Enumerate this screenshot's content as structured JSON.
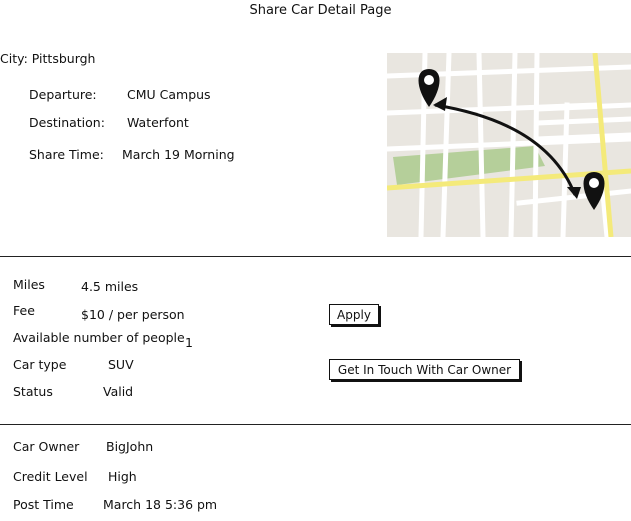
{
  "page": {
    "title": "Share Car Detail Page"
  },
  "city": {
    "label": "City:",
    "value": "Pittsburgh"
  },
  "trip": {
    "departure_label": "Departure:",
    "departure_value": "CMU Campus",
    "destination_label": "Destination:",
    "destination_value": "Waterfont",
    "share_time_label": "Share Time:",
    "share_time_value": "March 19 Morning"
  },
  "details": {
    "miles_label": "Miles",
    "miles_value": "4.5 miles",
    "fee_label": "Fee",
    "fee_value": "$10 / per person",
    "available_label": "Available number of people",
    "available_value": "1",
    "car_type_label": "Car type",
    "car_type_value": "SUV",
    "status_label": "Status",
    "status_value": "Valid"
  },
  "actions": {
    "apply_label": "Apply",
    "contact_label": "Get In Touch With Car Owner"
  },
  "owner": {
    "owner_label": "Car Owner",
    "owner_value": "BigJohn",
    "credit_label": "Credit Level",
    "credit_value": "High",
    "post_time_label": "Post Time",
    "post_time_value": "March 18 5:36 pm"
  },
  "map": {
    "icons": [
      "map-pin-icon",
      "map-pin-icon",
      "route-arrow-icon"
    ],
    "colors": {
      "land": "#e9e6e0",
      "road": "#ffffff",
      "major_road": "#f4ea7a",
      "park": "#b5cf9a",
      "pin": "#111111"
    }
  }
}
